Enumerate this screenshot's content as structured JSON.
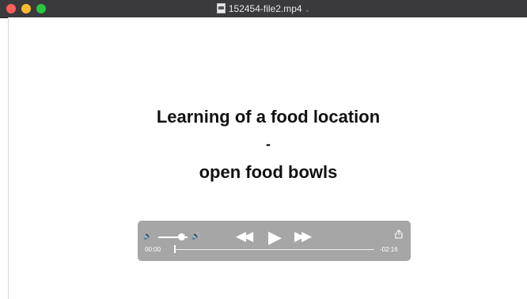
{
  "window": {
    "title": "152454-file2.mp4",
    "title_chevron": "⌄",
    "file_icon": "document-icon"
  },
  "video": {
    "lines": [
      "Learning of a food location",
      "-",
      "open food bowls"
    ]
  },
  "controls": {
    "volume_low_icon": "speaker-low-icon",
    "volume_high_icon": "speaker-high-icon",
    "volume_level": 0.8,
    "rewind_icon": "rewind-icon",
    "play_icon": "play-icon",
    "forward_icon": "fast-forward-icon",
    "share_icon": "share-icon",
    "elapsed": "00:00",
    "remaining": "-02:16",
    "progress": 0.0
  },
  "colors": {
    "titlebar": "#3a3a3c",
    "controls_bg": "#a6a6a6",
    "close": "#ff5f57",
    "minimize": "#febc2e",
    "zoom": "#28c840"
  }
}
